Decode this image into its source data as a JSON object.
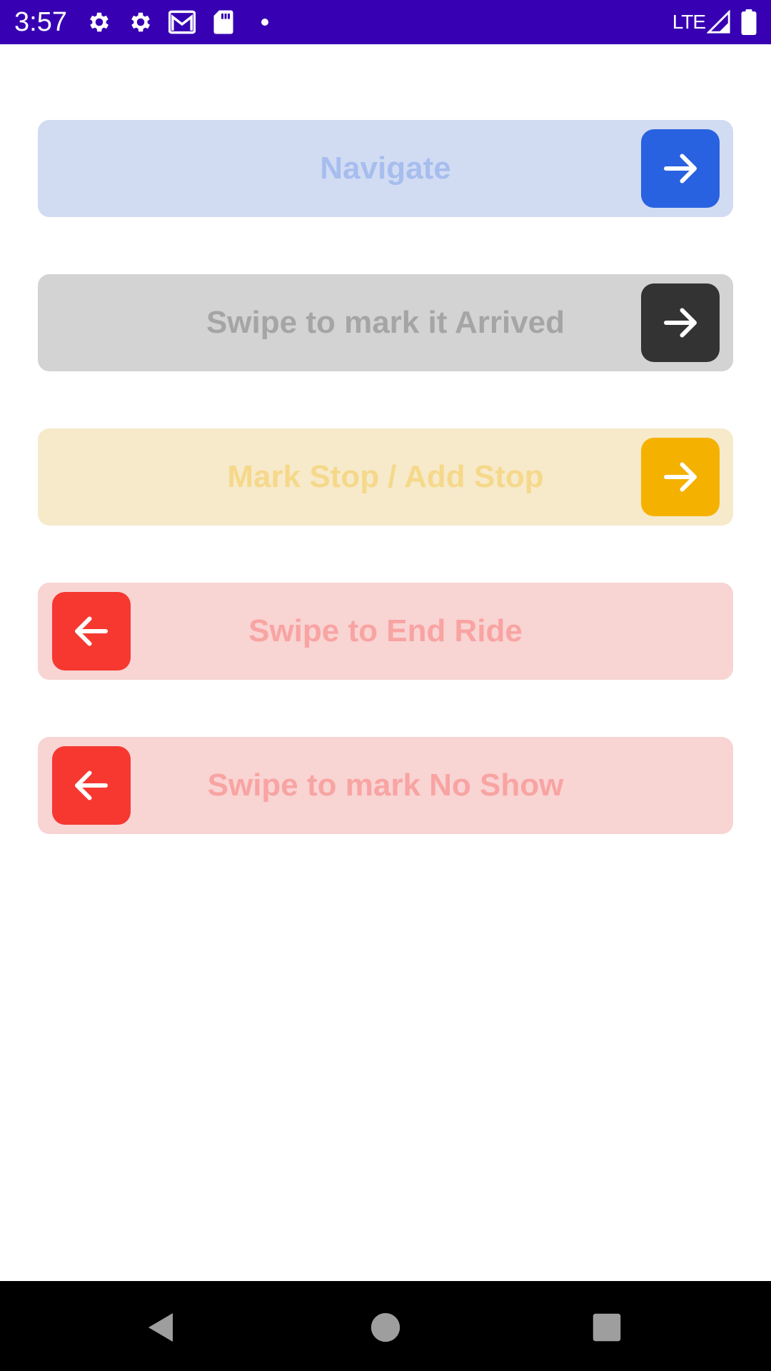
{
  "status_bar": {
    "time": "3:57",
    "network": "LTE",
    "icons_left": [
      "settings-icon",
      "settings-icon",
      "gmail-icon",
      "sd-card-icon",
      "notification-dot-icon"
    ],
    "icons_right": [
      "signal-icon",
      "battery-icon"
    ],
    "background": "#3700b3"
  },
  "swipe_buttons": [
    {
      "label": "Navigate",
      "direction": "right",
      "icon": "arrow-right-icon",
      "track_color": "#d1dcf3",
      "text_color": "#a7bdee",
      "handle_color": "#2962e0"
    },
    {
      "label": "Swipe to mark it Arrived",
      "direction": "right",
      "icon": "arrow-right-icon",
      "track_color": "#d3d3d3",
      "text_color": "#a5a5a5",
      "handle_color": "#333333"
    },
    {
      "label": "Mark Stop / Add Stop",
      "direction": "right",
      "icon": "arrow-right-icon",
      "track_color": "#f6eacb",
      "text_color": "#f6d88a",
      "handle_color": "#f5b100"
    },
    {
      "label": "Swipe to End Ride",
      "direction": "left",
      "icon": "arrow-left-icon",
      "track_color": "#f8d4d3",
      "text_color": "#f8a4a2",
      "handle_color": "#f63831"
    },
    {
      "label": "Swipe to mark No Show",
      "direction": "left",
      "icon": "arrow-left-icon",
      "track_color": "#f8d4d3",
      "text_color": "#f8a4a2",
      "handle_color": "#f63831"
    }
  ],
  "nav_bar": {
    "buttons": [
      "back-icon",
      "home-icon",
      "recents-icon"
    ]
  }
}
